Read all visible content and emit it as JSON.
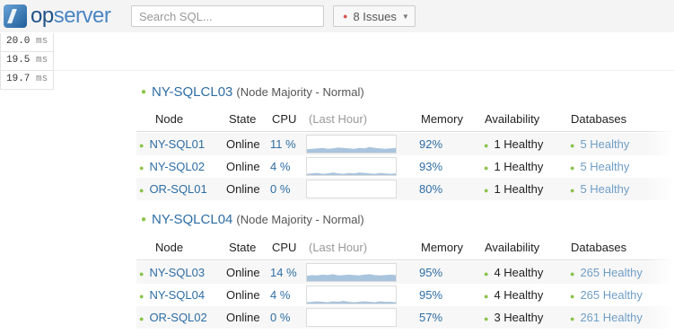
{
  "header": {
    "logo_op": "op",
    "logo_server": "server",
    "search_placeholder": "Search SQL...",
    "issues_label": "8 Issues"
  },
  "timings": [
    {
      "value": "20.0",
      "unit": "ms"
    },
    {
      "value": "19.5",
      "unit": "ms"
    },
    {
      "value": "19.7",
      "unit": "ms"
    }
  ],
  "columns": {
    "node": "Node",
    "state": "State",
    "cpu": "CPU",
    "last_hour": "(Last Hour)",
    "memory": "Memory",
    "availability": "Availability",
    "databases": "Databases"
  },
  "clusters": [
    {
      "name": "NY-SQLCL03",
      "detail": "(Node Majority - Normal)",
      "nodes": [
        {
          "name": "NY-SQL01",
          "state": "Online",
          "cpu": "11 %",
          "memory": "92%",
          "availability": "1 Healthy",
          "databases": "5 Healthy",
          "cpu_history": [
            8,
            9,
            10,
            11,
            9,
            10,
            12,
            11,
            10,
            9,
            11,
            10,
            13,
            11,
            10,
            9,
            10,
            11
          ]
        },
        {
          "name": "NY-SQL02",
          "state": "Online",
          "cpu": "4 %",
          "memory": "93%",
          "availability": "1 Healthy",
          "databases": "5 Healthy",
          "cpu_history": [
            3,
            4,
            5,
            3,
            4,
            6,
            4,
            3,
            5,
            4,
            6,
            5,
            4,
            3,
            5,
            4,
            3,
            4
          ]
        },
        {
          "name": "OR-SQL01",
          "state": "Online",
          "cpu": "0 %",
          "memory": "80%",
          "availability": "1 Healthy",
          "databases": "5 Healthy",
          "cpu_history": [
            0,
            0,
            0,
            0,
            0,
            0,
            0,
            0,
            0,
            0,
            0,
            0,
            0,
            0,
            0,
            0,
            0,
            0
          ]
        }
      ]
    },
    {
      "name": "NY-SQLCL04",
      "detail": "(Node Majority - Normal)",
      "nodes": [
        {
          "name": "NY-SQL03",
          "state": "Online",
          "cpu": "14 %",
          "memory": "95%",
          "availability": "4 Healthy",
          "databases": "265 Healthy",
          "cpu_history": [
            12,
            14,
            13,
            15,
            14,
            16,
            13,
            14,
            15,
            14,
            13,
            15,
            16,
            14,
            13,
            14,
            15,
            14
          ]
        },
        {
          "name": "NY-SQL04",
          "state": "Online",
          "cpu": "4 %",
          "memory": "95%",
          "availability": "4 Healthy",
          "databases": "265 Healthy",
          "cpu_history": [
            3,
            4,
            5,
            4,
            3,
            5,
            4,
            6,
            4,
            3,
            4,
            5,
            4,
            3,
            5,
            4,
            4,
            3
          ]
        },
        {
          "name": "OR-SQL02",
          "state": "Online",
          "cpu": "0 %",
          "memory": "57%",
          "availability": "3 Healthy",
          "databases": "261 Healthy",
          "cpu_history": [
            0,
            0,
            0,
            0,
            0,
            0,
            0,
            0,
            0,
            0,
            0,
            0,
            0,
            0,
            0,
            0,
            0,
            0
          ]
        }
      ]
    }
  ],
  "colors": {
    "link": "#2e6da4",
    "healthy": "#8bc34a",
    "issue": "#d9534f",
    "spark": "#a9c4dd"
  }
}
